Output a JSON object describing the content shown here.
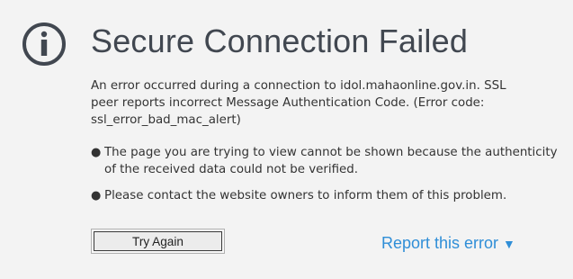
{
  "error_page": {
    "icon": "info-circle-icon",
    "title": "Secure Connection Failed",
    "description": "An error occurred during a connection to idol.mahaonline.gov.in. SSL peer reports incorrect Message Authentication Code. (Error code: ssl_error_bad_mac_alert)",
    "reasons": [
      "The page you are trying to view cannot be shown because the authenticity of the received data could not be verified.",
      "Please contact the website owners to inform them of this problem."
    ],
    "bullet": "●",
    "try_again_label": "Try Again",
    "report_label": "Report this error",
    "report_arrow": "▼"
  },
  "colors": {
    "background": "#f3f3f3",
    "title": "#414750",
    "icon": "#414750",
    "link": "#2f8ed7",
    "text": "#333333"
  }
}
